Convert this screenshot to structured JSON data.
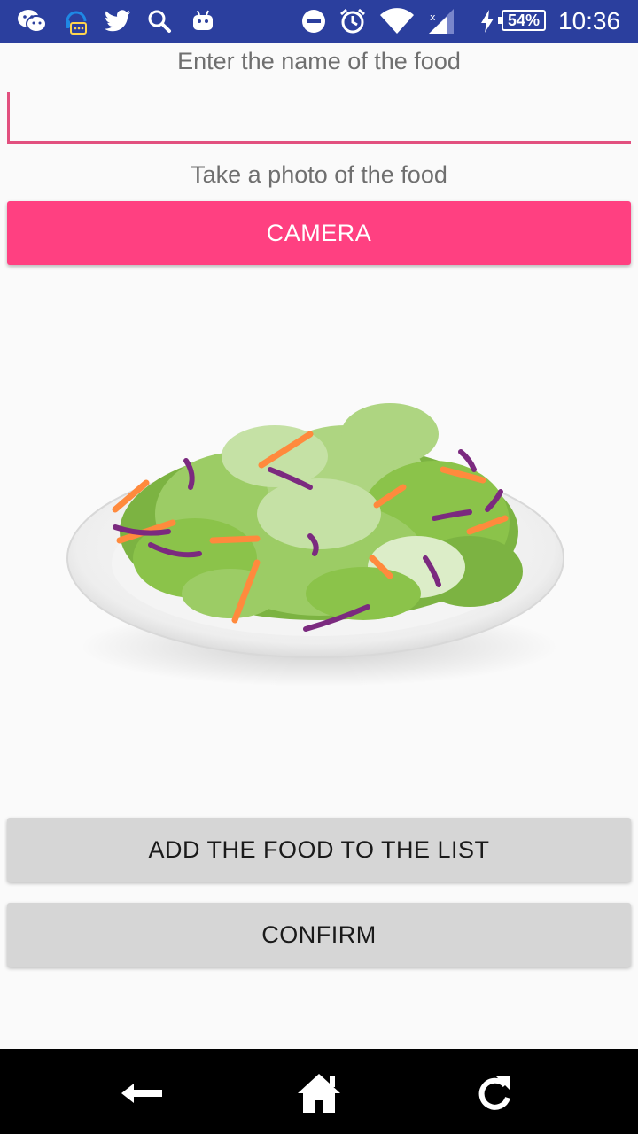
{
  "status_bar": {
    "background_color": "#2b3f9e",
    "left_icons": [
      "wechat-icon",
      "headset-chat-icon",
      "twitter-icon",
      "search-icon",
      "android-robot-icon"
    ],
    "right_icons": [
      "do-not-disturb-icon",
      "alarm-icon",
      "wifi-icon",
      "cell-signal-icon",
      "charging-bolt-icon"
    ],
    "battery_level": "54%",
    "time": "10:36"
  },
  "form": {
    "name_label": "Enter the name of the food",
    "name_input_value": "",
    "name_input_placeholder": "",
    "photo_label": "Take a photo of the food",
    "camera_button_label": "CAMERA",
    "add_button_label": "ADD THE FOOD TO THE LIST",
    "confirm_button_label": "CONFIRM",
    "accent_color": "#ff4081",
    "input_underline_color": "#e2507f",
    "secondary_button_color": "#d6d6d6"
  },
  "image": {
    "subject": "salad-plate"
  },
  "nav_bar": {
    "icons": [
      "back-arrow-icon",
      "home-icon",
      "refresh-icon"
    ]
  }
}
